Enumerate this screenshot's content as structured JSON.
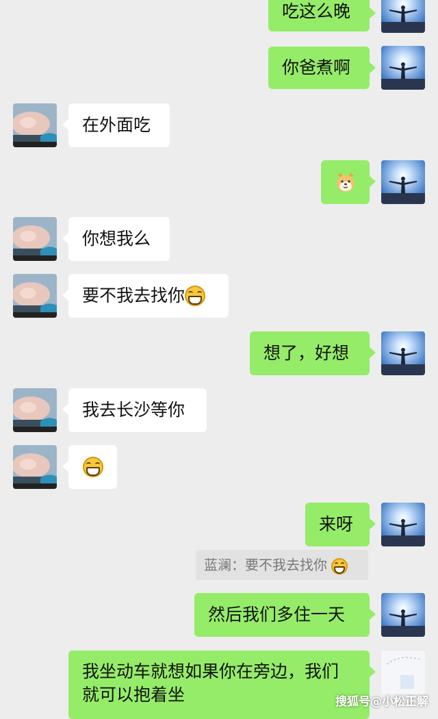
{
  "messages": [
    {
      "side": "right",
      "text": "吃这么晚"
    },
    {
      "side": "right",
      "text": "你爸煮啊"
    },
    {
      "side": "left",
      "text": "在外面吃"
    },
    {
      "side": "right",
      "sticker": "dog-emoji"
    },
    {
      "side": "left",
      "text": "你想我么"
    },
    {
      "side": "left",
      "text": "要不我去找你",
      "emoji": "grin-emoji"
    },
    {
      "side": "right",
      "text": "想了，好想"
    },
    {
      "side": "left",
      "text": "我去长沙等你"
    },
    {
      "side": "left",
      "emoji": "grin-emoji"
    },
    {
      "side": "right",
      "text": "来呀"
    },
    {
      "side": "right",
      "text": "然后我们多住一天"
    },
    {
      "side": "right",
      "text_line1": "我坐动车就想如果你在旁边，我们",
      "text_line2": "就可以抱着坐"
    }
  ],
  "quote": {
    "text": "蓝澜：要不我去找你",
    "emoji": "grin-emoji"
  },
  "watermark": "搜狐号@小松正解",
  "colors": {
    "background": "#ededed",
    "self_bubble": "#95ec69",
    "other_bubble": "#ffffff",
    "quote_bg": "#e2e2e2"
  }
}
